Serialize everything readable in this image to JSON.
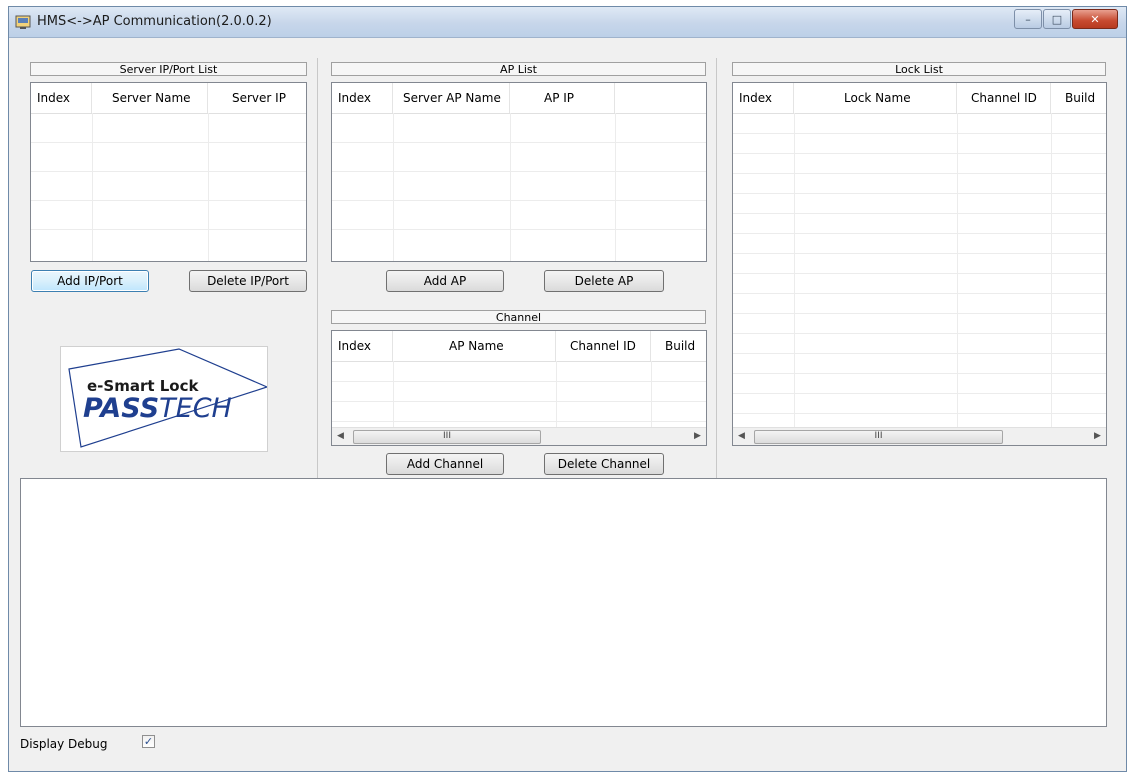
{
  "window": {
    "title": "HMS<->AP Communication(2.0.0.2)"
  },
  "server_list": {
    "header": "Server IP/Port List",
    "columns": [
      "Index",
      "Server Name",
      "Server IP"
    ],
    "add_button": "Add IP/Port",
    "delete_button": "Delete IP/Port"
  },
  "ap_list": {
    "header": "AP List",
    "columns": [
      "Index",
      "Server AP Name",
      "AP IP",
      ""
    ],
    "add_button": "Add AP",
    "delete_button": "Delete AP"
  },
  "channel": {
    "header": "Channel",
    "columns": [
      "Index",
      "AP Name",
      "Channel ID",
      "Build"
    ],
    "add_button": "Add Channel",
    "delete_button": "Delete Channel"
  },
  "lock_list": {
    "header": "Lock List",
    "columns": [
      "Index",
      "Lock Name",
      "Channel ID",
      "Build"
    ]
  },
  "logo": {
    "line1": "e-Smart Lock",
    "line2a": "PASS",
    "line2b": "TECH"
  },
  "debug": {
    "label": "Display Debug",
    "checked": true,
    "check_glyph": "✓"
  },
  "scroll_thumb_glyph": "III",
  "colors": {
    "accent": "#3c7fb1",
    "logo_text": "#1f3f8f",
    "close_button": "#c74a2f"
  }
}
